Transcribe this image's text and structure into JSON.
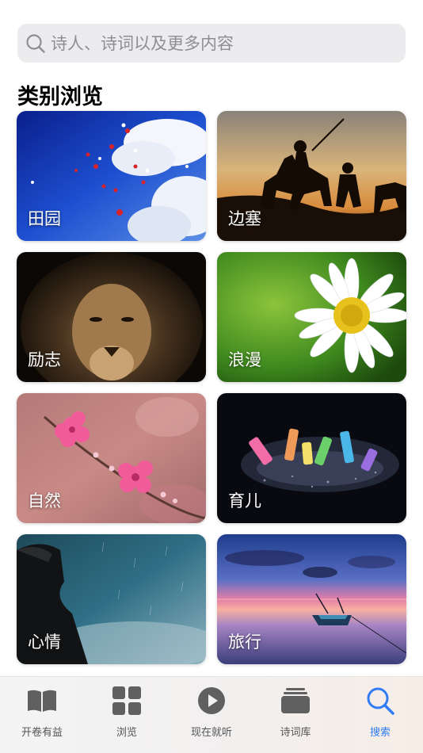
{
  "search": {
    "placeholder": "诗人、诗词以及更多内容"
  },
  "section": {
    "title": "类别浏览"
  },
  "categories": [
    {
      "label": "田园"
    },
    {
      "label": "边塞"
    },
    {
      "label": "励志"
    },
    {
      "label": "浪漫"
    },
    {
      "label": "自然"
    },
    {
      "label": "育儿"
    },
    {
      "label": "心情"
    },
    {
      "label": "旅行"
    }
  ],
  "tabbar": {
    "active_color": "#2f7cf6",
    "items": [
      {
        "label": "开卷有益",
        "icon": "open-book-icon"
      },
      {
        "label": "浏览",
        "icon": "grid-icon"
      },
      {
        "label": "现在就听",
        "icon": "play-circle-icon"
      },
      {
        "label": "诗词库",
        "icon": "stack-icon"
      },
      {
        "label": "搜索",
        "icon": "search-icon",
        "active": true
      }
    ]
  }
}
